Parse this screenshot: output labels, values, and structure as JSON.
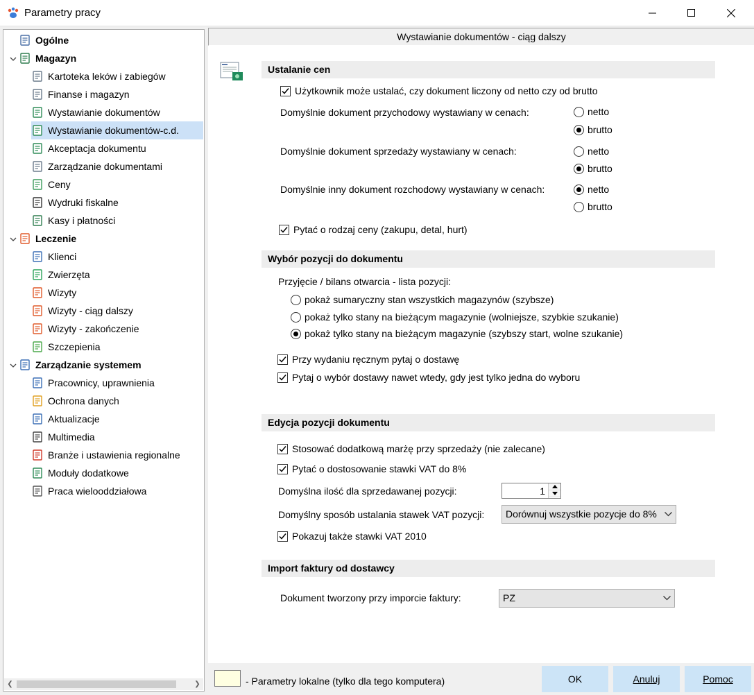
{
  "window": {
    "title": "Parametry pracy",
    "controls": [
      "minimize",
      "maximize",
      "close"
    ]
  },
  "tree": {
    "items": [
      {
        "label": "Ogólne",
        "level": 0,
        "bold": true,
        "icon": "settings-computer-icon"
      },
      {
        "label": "Magazyn",
        "level": 0,
        "bold": true,
        "expanded": true,
        "icon": "warehouse-icon"
      },
      {
        "label": "Kartoteka leków i zabiegów",
        "level": 1,
        "icon": "medicine-card-icon"
      },
      {
        "label": "Finanse i magazyn",
        "level": 1,
        "icon": "document-icon"
      },
      {
        "label": "Wystawianie dokumentów",
        "level": 1,
        "icon": "document-add-icon"
      },
      {
        "label": "Wystawianie dokumentów-c.d.",
        "level": 1,
        "selected": true,
        "icon": "document-add-icon"
      },
      {
        "label": "Akceptacja dokumentu",
        "level": 1,
        "icon": "document-accept-icon"
      },
      {
        "label": "Zarządzanie dokumentami",
        "level": 1,
        "icon": "documents-icon"
      },
      {
        "label": "Ceny",
        "level": 1,
        "icon": "money-icon"
      },
      {
        "label": "Wydruki fiskalne",
        "level": 1,
        "icon": "printer-icon"
      },
      {
        "label": "Kasy i płatności",
        "level": 1,
        "icon": "cash-register-icon"
      },
      {
        "label": "Leczenie",
        "level": 0,
        "bold": true,
        "expanded": true,
        "icon": "clipboard-icon"
      },
      {
        "label": "Klienci",
        "level": 1,
        "icon": "person-icon"
      },
      {
        "label": "Zwierzęta",
        "level": 1,
        "icon": "paw-icon"
      },
      {
        "label": "Wizyty",
        "level": 1,
        "icon": "clipboard-icon"
      },
      {
        "label": "Wizyty - ciąg dalszy",
        "level": 1,
        "icon": "clipboard-icon"
      },
      {
        "label": "Wizyty - zakończenie",
        "level": 1,
        "icon": "clipboard-icon"
      },
      {
        "label": "Szczepienia",
        "level": 1,
        "icon": "syringe-icon"
      },
      {
        "label": "Zarządzanie systemem",
        "level": 0,
        "bold": true,
        "expanded": true,
        "icon": "system-icon"
      },
      {
        "label": "Pracownicy, uprawnienia",
        "level": 1,
        "icon": "users-icon"
      },
      {
        "label": "Ochrona danych",
        "level": 1,
        "icon": "lock-icon"
      },
      {
        "label": "Aktualizacje",
        "level": 1,
        "icon": "update-icon"
      },
      {
        "label": "Multimedia",
        "level": 1,
        "icon": "multimedia-icon"
      },
      {
        "label": "Branże i ustawienia regionalne",
        "level": 1,
        "icon": "region-icon"
      },
      {
        "label": "Moduły dodatkowe",
        "level": 1,
        "icon": "module-add-icon"
      },
      {
        "label": "Praca wielooddziałowa",
        "level": 1,
        "icon": "home-icon"
      }
    ]
  },
  "content": {
    "header": "Wystawianie dokumentów - ciąg dalszy",
    "sections": {
      "ceny": {
        "title": "Ustalanie cen",
        "user_can_set": {
          "label": "Użytkownik może ustalać, czy dokument liczony od netto czy od brutto",
          "checked": true
        },
        "przychodowy": {
          "label": "Domyślnie dokument przychodowy wystawiany w cenach:",
          "options": [
            "netto",
            "brutto"
          ],
          "selected": "brutto"
        },
        "sprzedazy": {
          "label": "Domyślnie dokument sprzedaży wystawiany w cenach:",
          "options": [
            "netto",
            "brutto"
          ],
          "selected": "brutto"
        },
        "rozchodowy": {
          "label": "Domyślnie inny dokument rozchodowy wystawiany w cenach:",
          "options": [
            "netto",
            "brutto"
          ],
          "selected": "netto"
        },
        "ask_price_type": {
          "label": "Pytać o rodzaj ceny (zakupu, detal, hurt)",
          "checked": true
        }
      },
      "wybor": {
        "title": "Wybór pozycji do dokumentu",
        "list_label": "Przyjęcie / bilans otwarcia - lista pozycji:",
        "options": [
          "pokaż sumaryczny stan wszystkich magazynów (szybsze)",
          "pokaż tylko stany na bieżącym magazynie (wolniejsze, szybkie szukanie)",
          "pokaż tylko stany na bieżącym magazynie (szybszy start, wolne szukanie)"
        ],
        "selected_index": 2,
        "ask_delivery": {
          "label": "Przy wydaniu ręcznym pytaj o dostawę",
          "checked": true
        },
        "ask_delivery_single": {
          "label": "Pytaj o wybór dostawy nawet wtedy, gdy jest tylko jedna do wyboru",
          "checked": true
        }
      },
      "edycja": {
        "title": "Edycja pozycji dokumentu",
        "extra_margin": {
          "label": "Stosować dodatkową marżę przy sprzedaży (nie zalecane)",
          "checked": true
        },
        "vat_8": {
          "label": "Pytać o dostosowanie stawki VAT do 8%",
          "checked": true
        },
        "default_qty_label": "Domyślna ilość dla sprzedawanej pozycji:",
        "default_qty_value": "1",
        "vat_method_label": "Domyślny sposób ustalania stawek VAT pozycji:",
        "vat_method_value": "Dorównuj wszystkie pozycje do 8%",
        "show_vat_2010": {
          "label": "Pokazuj także stawki VAT 2010",
          "checked": true
        }
      },
      "import": {
        "title": "Import faktury od dostawcy",
        "doc_label": "Dokument tworzony przy imporcie faktury:",
        "doc_value": "PZ"
      }
    }
  },
  "footer": {
    "legend_text": "- Parametry lokalne (tylko dla tego komputera)",
    "ok": "OK",
    "cancel": "Anuluj",
    "help": "Pomoc"
  },
  "colors": {
    "selection": "#cce1f7",
    "button_bg": "#cce4f7",
    "section_bg": "#ededed",
    "legend_bg": "#ffffe1"
  }
}
